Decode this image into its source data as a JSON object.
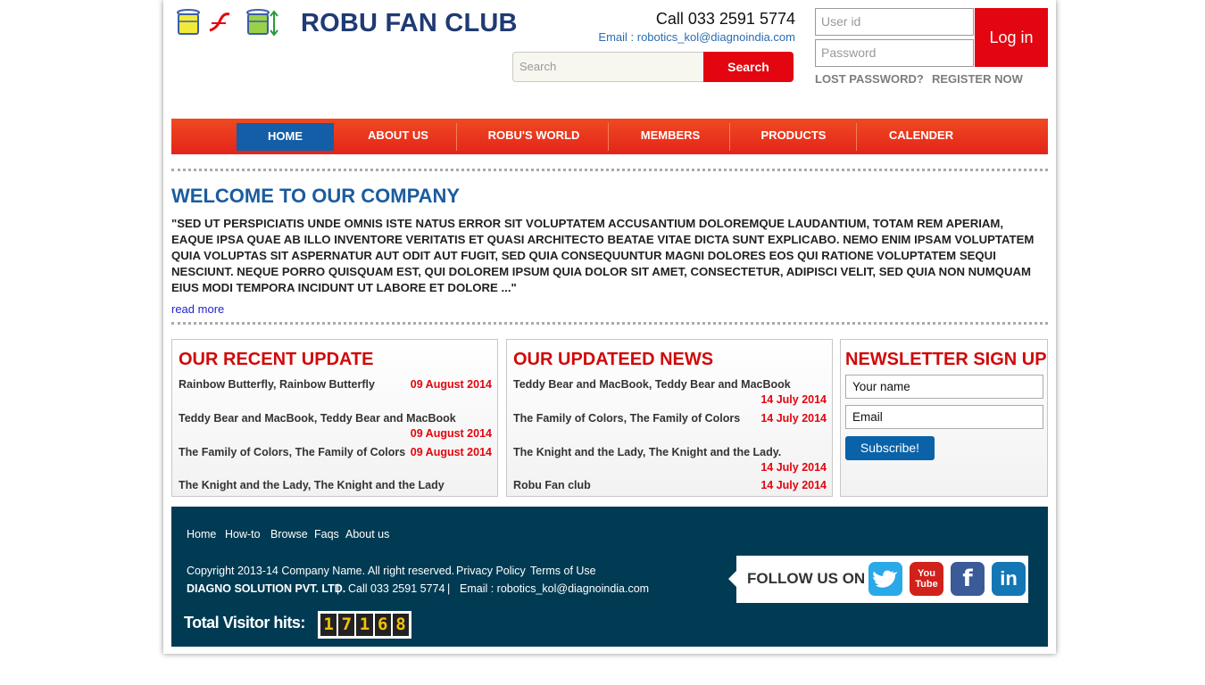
{
  "header": {
    "title": "ROBU FAN CLUB",
    "call": "Call 033 2591 5774",
    "email": "Email : robotics_kol@diagnoindia.com",
    "search_placeholder": "Search",
    "search_button": "Search",
    "userid_placeholder": "User id",
    "password_placeholder": "Password",
    "login_button": "Log in",
    "lost_password": "LOST PASSWORD?",
    "register": "REGISTER NOW"
  },
  "nav": {
    "items": [
      "HOME",
      "ABOUT US",
      "ROBU'S WORLD",
      "MEMBERS",
      "PRODUCTS",
      "CALENDER"
    ],
    "active": "HOME"
  },
  "welcome": {
    "title": "WELCOME TO OUR COMPANY",
    "text": "\"SED UT PERSPICIATIS UNDE OMNIS ISTE NATUS ERROR SIT VOLUPTATEM ACCUSANTIUM DOLOREMQUE LAUDANTIUM, TOTAM REM APERIAM, EAQUE IPSA QUAE AB ILLO INVENTORE VERITATIS ET QUASI ARCHITECTO BEATAE VITAE DICTA SUNT EXPLICABO. NEMO ENIM IPSAM VOLUPTATEM QUIA VOLUPTAS SIT ASPERNATUR AUT ODIT AUT FUGIT, SED QUIA CONSEQUUNTUR MAGNI DOLORES EOS QUI RATIONE VOLUPTATEM SEQUI NESCIUNT. NEQUE PORRO QUISQUAM EST, QUI DOLOREM IPSUM QUIA DOLOR SIT AMET, CONSECTETUR, ADIPISCI VELIT, SED QUIA NON NUMQUAM EIUS MODI TEMPORA INCIDUNT UT LABORE ET DOLORE ...\"",
    "read_more": "read more"
  },
  "recent_update": {
    "title": "OUR RECENT UPDATE",
    "items": [
      {
        "text": "Rainbow Butterfly, Rainbow Butterfly",
        "date": "09 August 2014"
      },
      {
        "text": "Teddy Bear and MacBook, Teddy Bear and MacBook",
        "date": "09 August 2014"
      },
      {
        "text": "The Family of Colors, The Family of Colors",
        "date": "09 August 2014"
      },
      {
        "text": "The Knight and the Lady, The Knight and the Lady",
        "date": ""
      }
    ]
  },
  "updated_news": {
    "title": "OUR UPDATEED NEWS",
    "items": [
      {
        "text": "Teddy Bear and MacBook, Teddy Bear and MacBook",
        "date": "14 July 2014"
      },
      {
        "text": "The Family of Colors, The Family of Colors",
        "date": "14 July 2014"
      },
      {
        "text": "The Knight and the Lady, The Knight and the Lady.",
        "date": "14 July 2014"
      },
      {
        "text": "Robu Fan club",
        "date": "14 July 2014"
      }
    ]
  },
  "newsletter": {
    "title": "NEWSLETTER SIGN UP",
    "name_placeholder": "Your name",
    "email_placeholder": "Email",
    "button": "Subscribe!"
  },
  "footer": {
    "links": [
      "Home",
      "How-to",
      "Browse",
      "Faqs",
      "About us"
    ],
    "copyright": "Copyright 2013-14 Company Name. All right reserved.",
    "privacy": "Privacy Policy",
    "terms": "Terms of Use",
    "company": "DIAGNO SOLUTION PVT. LTD.",
    "sep": "|",
    "call": "Call 033 2591 5774",
    "email": "Email : robotics_kol@diagnoindia.com",
    "follow": "FOLLOW US ON",
    "social": [
      "twitter",
      "youtube",
      "facebook",
      "linkedin"
    ],
    "visitor_label": "Total Visitor hits:",
    "visitor_digits": [
      "1",
      "7",
      "1",
      "6",
      "8"
    ]
  },
  "colors": {
    "accent_red": "#e3050f",
    "brand_blue": "#1f3a74",
    "footer_bg": "#003b53",
    "nav_active": "#135ea6"
  }
}
